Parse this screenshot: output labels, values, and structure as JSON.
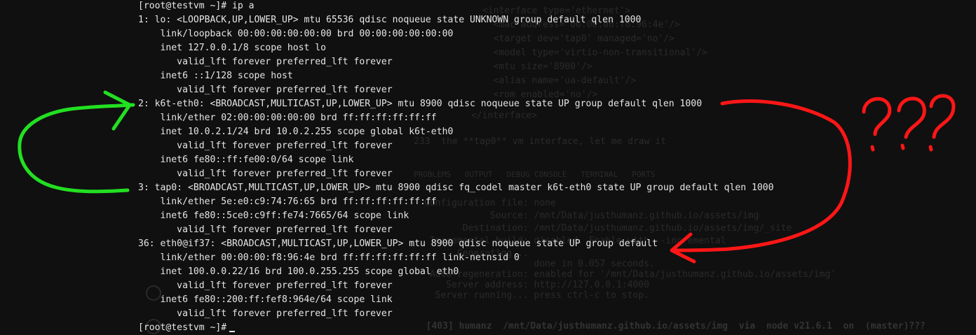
{
  "terminal": {
    "lines": [
      "[root@testvm ~]# ip a",
      "1: lo: <LOOPBACK,UP,LOWER_UP> mtu 65536 qdisc noqueue state UNKNOWN group default qlen 1000",
      "    link/loopback 00:00:00:00:00:00 brd 00:00:00:00:00:00",
      "    inet 127.0.0.1/8 scope host lo",
      "       valid_lft forever preferred_lft forever",
      "    inet6 ::1/128 scope host",
      "       valid_lft forever preferred_lft forever",
      "2: k6t-eth0: <BROADCAST,MULTICAST,UP,LOWER_UP> mtu 8900 qdisc noqueue state UP group default qlen 1000",
      "    link/ether 02:00:00:00:00:00 brd ff:ff:ff:ff:ff:ff",
      "    inet 10.0.2.1/24 brd 10.0.2.255 scope global k6t-eth0",
      "       valid_lft forever preferred_lft forever",
      "    inet6 fe80::ff:fe00:0/64 scope link",
      "       valid_lft forever preferred_lft forever",
      "3: tap0: <BROADCAST,MULTICAST,UP,LOWER_UP> mtu 8900 qdisc fq_codel master k6t-eth0 state UP group default qlen 1000",
      "    link/ether 5e:e0:c9:74:76:65 brd ff:ff:ff:ff:ff:ff",
      "    inet6 fe80::5ce0:c9ff:fe74:7665/64 scope link",
      "       valid_lft forever preferred_lft forever",
      "36: eth0@if37: <BROADCAST,MULTICAST,UP,LOWER_UP> mtu 8900 qdisc noqueue state UP group default",
      "    link/ether 00:00:00:f8:96:4e brd ff:ff:ff:ff:ff:ff link-netnsid 0",
      "    inet 100.0.0.22/16 brd 100.0.255.255 scope global eth0",
      "       valid_lft forever preferred_lft forever",
      "    inet6 fe80::200:ff:fef8:964e/64 scope link",
      "       valid_lft forever preferred_lft forever",
      "[root@testvm ~]#"
    ]
  },
  "background": {
    "xml": [
      "<interface type='ethernet'>",
      "  <mac address='00:00:00:f8:96:4e'/>",
      "  <target dev='tap0' managed='no'/>",
      "  <model type='virtio-non-transitional'/>",
      "  <mtu size='8900'/>",
      "  <alias name='ua-default'/>",
      "  <rom enabled='no'/>",
      "</interface>"
    ],
    "note": "233  the **tap0** vm interface, let me draw it",
    "tabs": "PROBLEMS   OUTPUT   DEBUG CONSOLE   TERMINAL   PORTS",
    "server": [
      "Configuration file: none",
      "            Source: /mnt/Data/justhumanz.github.io/assets/img",
      "       Destination: /mnt/Data/justhumanz.github.io/assets/img/_site",
      " Incremental build: disabled. Enable with --incremental",
      "      Generating...",
      "                    done in 0.057 seconds.",
      " Auto-regeneration: enabled for '/mnt/Data/justhumanz.github.io/assets/img'",
      "    Server address: http://127.0.0.1:4000",
      "  Server running... press ctrl-c to stop."
    ],
    "prompt": "  [403] humanz  /mnt/Data/justhumanz.github.io/assets/img  via  node v21.6.1  on  (master)???"
  },
  "annotations": {
    "question_marks": "???",
    "green_color": "#22e022",
    "red_color": "#ff1616"
  }
}
